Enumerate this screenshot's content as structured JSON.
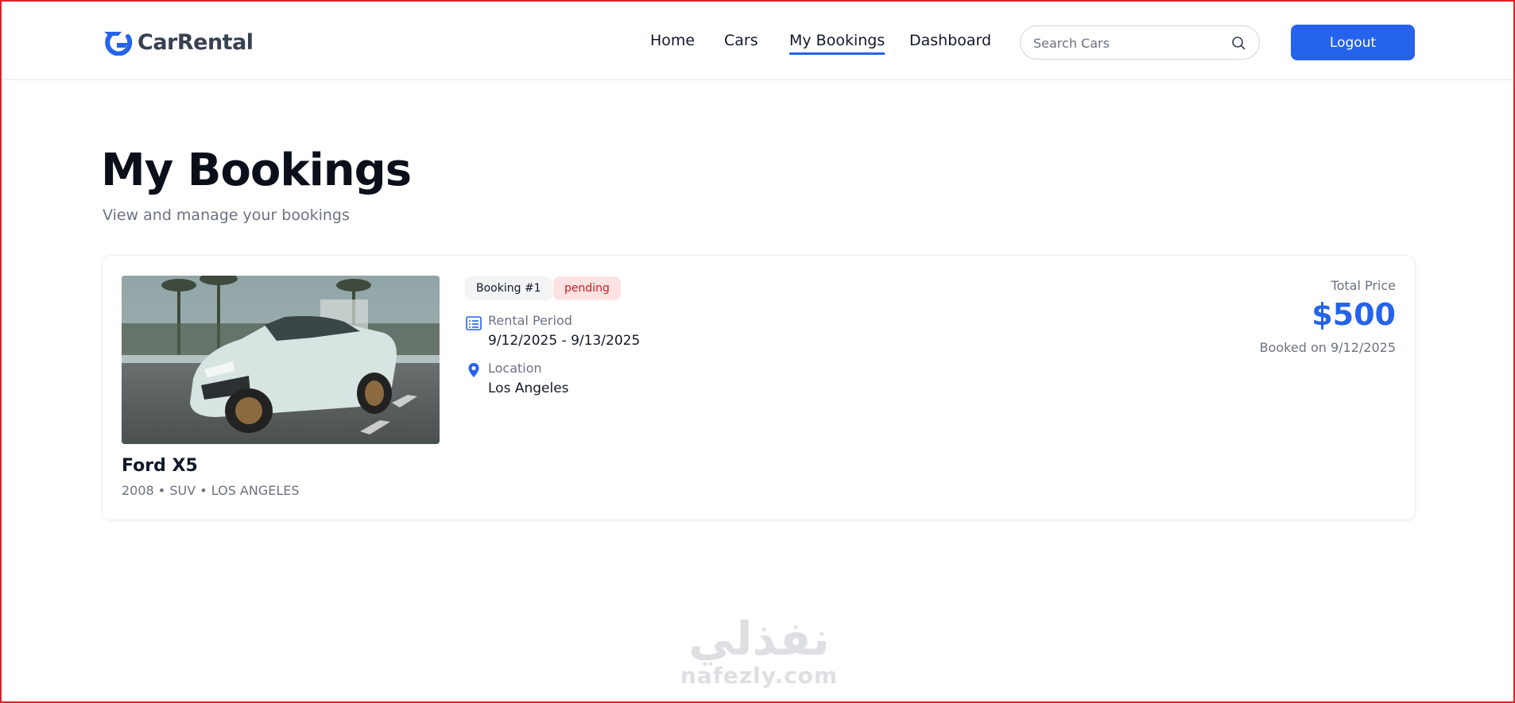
{
  "app": {
    "name": "CarRental"
  },
  "nav": {
    "items": [
      {
        "label": "Home",
        "active": false
      },
      {
        "label": "Cars",
        "active": false
      },
      {
        "label": "My Bookings",
        "active": true
      },
      {
        "label": "Dashboard",
        "active": false
      }
    ]
  },
  "search": {
    "placeholder": "Search Cars",
    "value": ""
  },
  "header": {
    "logout_label": "Logout"
  },
  "page": {
    "title": "My Bookings",
    "subtitle": "View and manage your bookings"
  },
  "booking": {
    "booking_label": "Booking #1",
    "status": "pending",
    "car_name": "Ford X5",
    "car_meta": "2008 • SUV • LOS ANGELES",
    "rental_period_label": "Rental Period",
    "rental_period": "9/12/2025 - 9/13/2025",
    "location_label": "Location",
    "location": "Los Angeles",
    "total_label": "Total Price",
    "total_price": "$500",
    "booked_on": "Booked on 9/12/2025"
  },
  "watermark": {
    "arabic": "نفذلي",
    "latin": "nafezly.com"
  },
  "colors": {
    "accent": "#2563eb",
    "status_bg": "#fde2e4",
    "status_text": "#c81e1e"
  }
}
